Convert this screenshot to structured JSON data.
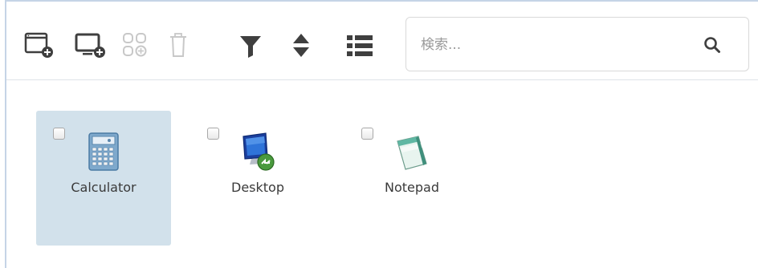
{
  "toolbar": {
    "buttons": [
      {
        "icon": "add-app-icon"
      },
      {
        "icon": "add-desktop-icon"
      },
      {
        "icon": "group-icon"
      },
      {
        "icon": "delete-icon"
      },
      {
        "icon": "filter-icon"
      },
      {
        "icon": "sort-icon"
      },
      {
        "icon": "view-list-icon"
      }
    ]
  },
  "search": {
    "placeholder": "検索...",
    "value": ""
  },
  "apps": [
    {
      "label": "Calculator",
      "icon": "calculator-icon",
      "selected": true,
      "checked": false
    },
    {
      "label": "Desktop",
      "icon": "remote-desktop-icon",
      "selected": false,
      "checked": false
    },
    {
      "label": "Notepad",
      "icon": "notepad-icon",
      "selected": false,
      "checked": false
    }
  ],
  "colors": {
    "selected_tile": "#d2e1eb",
    "icon_dark": "#3f3f3f",
    "icon_disabled": "#c8c8c8",
    "frame_border": "#c5d4e6"
  }
}
